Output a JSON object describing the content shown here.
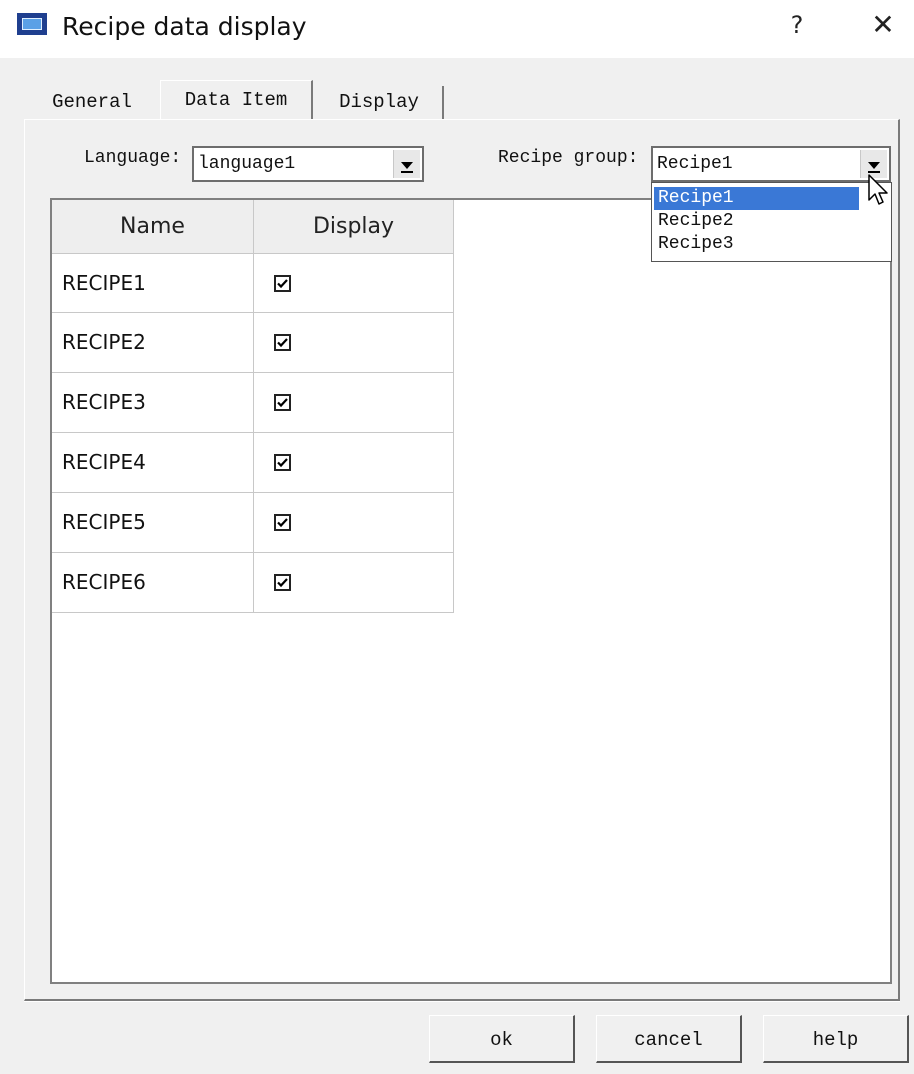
{
  "window": {
    "title": "Recipe data display",
    "help_glyph": "?",
    "close_glyph": "✕",
    "app_icon": "hmi-icon"
  },
  "tabs": [
    {
      "label": "General",
      "active": false
    },
    {
      "label": "Data Item",
      "active": true
    },
    {
      "label": "Display",
      "active": false
    }
  ],
  "language": {
    "label": "Language:",
    "value": "language1"
  },
  "recipe_group": {
    "label": "Recipe group:",
    "value": "Recipe1",
    "dropdown_open": true,
    "options": [
      "Recipe1",
      "Recipe2",
      "Recipe3"
    ],
    "highlighted_index": 0
  },
  "grid": {
    "columns": [
      "Name",
      "Display"
    ],
    "rows": [
      {
        "name": "RECIPE1",
        "display": true
      },
      {
        "name": "RECIPE2",
        "display": true
      },
      {
        "name": "RECIPE3",
        "display": true
      },
      {
        "name": "RECIPE4",
        "display": true
      },
      {
        "name": "RECIPE5",
        "display": true
      },
      {
        "name": "RECIPE6",
        "display": true
      }
    ]
  },
  "buttons": {
    "ok": "ok",
    "cancel": "cancel",
    "help": "help"
  },
  "colors": {
    "selection": "#3a78d6",
    "dialog_bg": "#f0f0f0"
  }
}
